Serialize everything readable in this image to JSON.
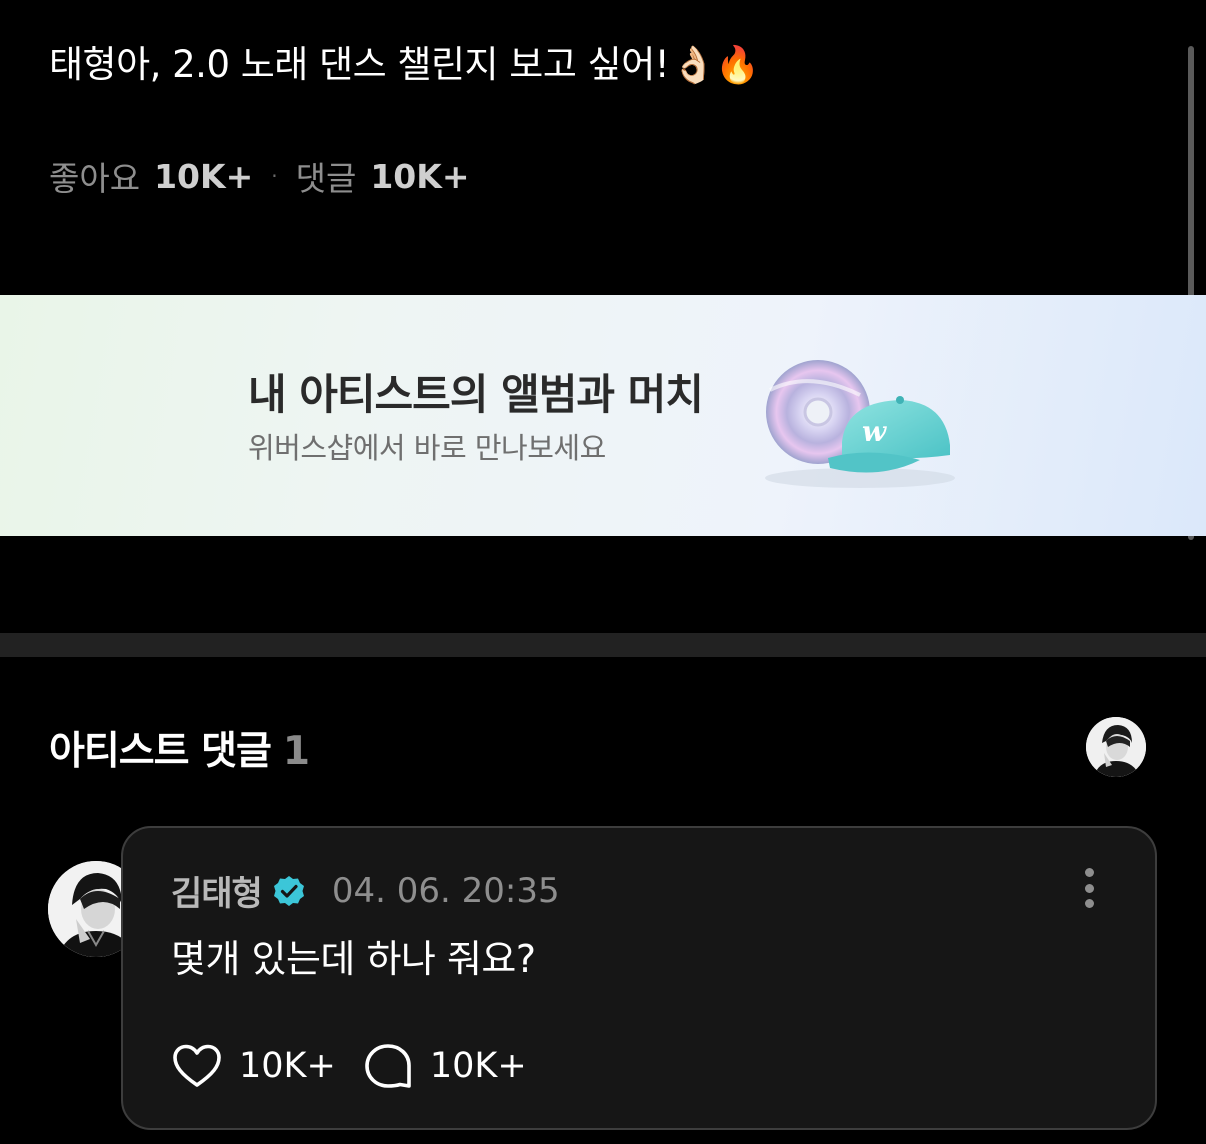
{
  "post": {
    "title": "태형아, 2.0 노래 댄스 챌린지 보고 싶어!",
    "emoji": "👌🏻🔥",
    "likes_label": "좋아요",
    "likes_count": "10K+",
    "separator": "·",
    "comments_label": "댓글",
    "comments_count": "10K+"
  },
  "banner": {
    "title": "내 아티스트의 앨범과 머치",
    "subtitle": "위버스샵에서 바로 만나보세요",
    "cap_logo": "w"
  },
  "artist_comments": {
    "title": "아티스트 댓글",
    "count": "1"
  },
  "comment": {
    "author": "김태형",
    "timestamp": "04. 06. 20:35",
    "text": "몇개 있는데 하나 줘요?",
    "likes": "10K+",
    "replies": "10K+"
  },
  "colors": {
    "background": "#000000",
    "card": "#161616",
    "verified": "#3cc6d8",
    "muted_text": "#8e8e8e"
  },
  "icons": {
    "verified": "verified-badge-icon",
    "like": "heart-icon",
    "reply": "speech-bubble-icon",
    "more": "more-vertical-icon"
  }
}
